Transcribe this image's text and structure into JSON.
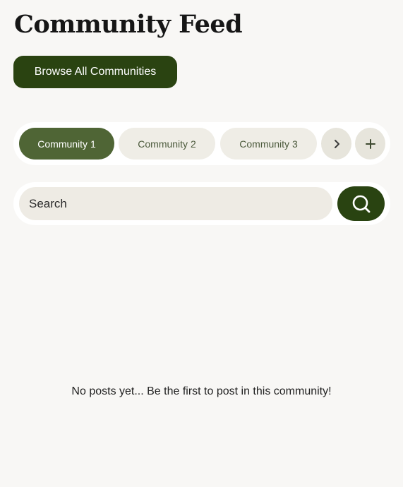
{
  "header": {
    "title": "Community Feed",
    "browse_label": "Browse All Communities"
  },
  "tabs": [
    {
      "label": "Community 1",
      "active": true
    },
    {
      "label": "Community 2",
      "active": false
    },
    {
      "label": "Community 3",
      "active": false
    }
  ],
  "tab_controls": {
    "next_icon": "chevron-right-icon",
    "add_icon": "plus-icon"
  },
  "search": {
    "placeholder": "Search",
    "icon": "search-icon"
  },
  "feed": {
    "empty_message": "No posts yet... Be the first to post in this community!"
  },
  "colors": {
    "background": "#f8f7f5",
    "primary": "#2a4311",
    "active_tab": "#4f6535",
    "tab_bg": "#efede6",
    "input_bg": "#eeebe4"
  }
}
